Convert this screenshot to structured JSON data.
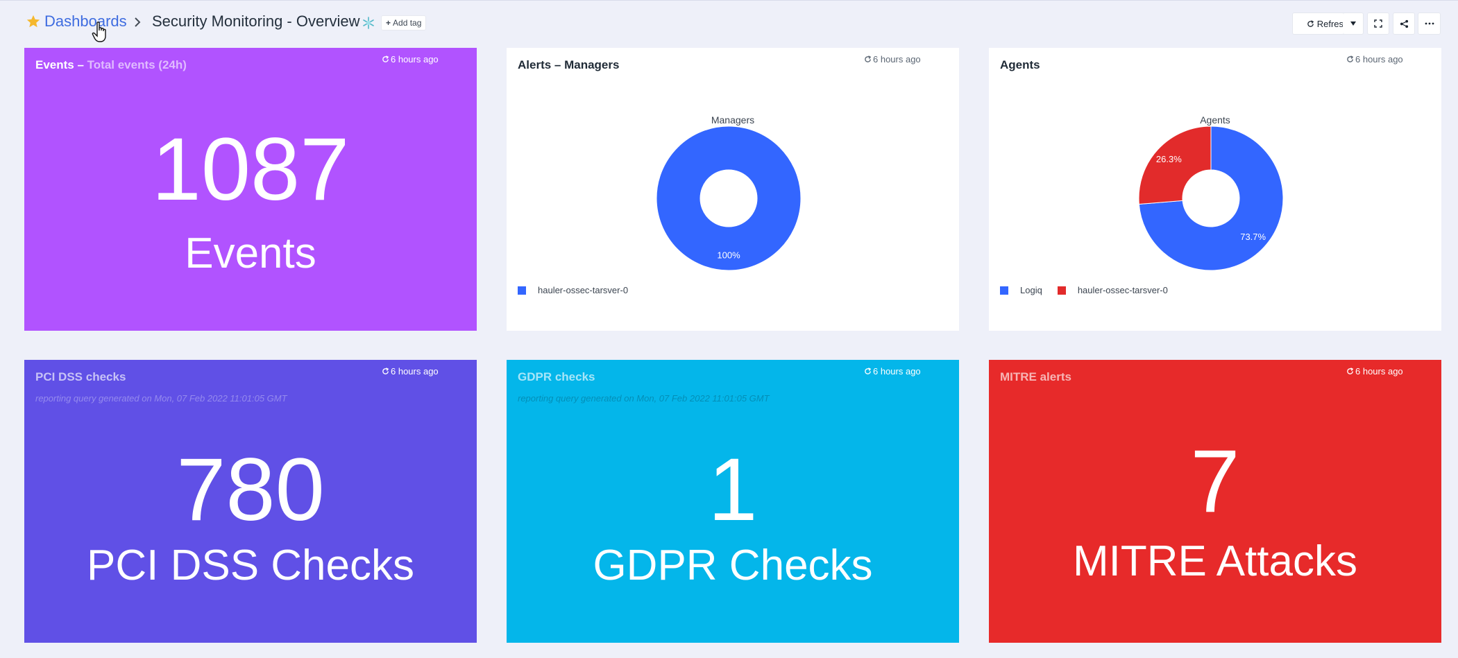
{
  "header": {
    "breadcrumb_link": "Dashboards",
    "title": "Security Monitoring - Overview",
    "add_tag": "Add tag",
    "refresh_label": "Refresh",
    "icons": [
      "star-icon",
      "chevron-right-icon",
      "tag-icon",
      "refresh-icon",
      "caret-down-icon",
      "fullscreen-icon",
      "share-icon",
      "more-icon"
    ]
  },
  "colors": {
    "accent": "#3e6ce0",
    "events": "#b153ff",
    "pci": "#6050e6",
    "gdpr": "#04b6ea",
    "mitre": "#e72a2a",
    "pie_blue": "#3366ff",
    "pie_red": "#e22b2b"
  },
  "panels": {
    "events": {
      "title": "Events",
      "subtitle": "Total events (24h)",
      "updated": "6 hours ago",
      "value": "1087",
      "label": "Events"
    },
    "alerts": {
      "title": "Alerts – Managers",
      "updated": "6 hours ago"
    },
    "agents": {
      "title": "Agents",
      "updated": "6 hours ago"
    },
    "pci": {
      "title": "PCI DSS checks",
      "updated": "6 hours ago",
      "description": "reporting query generated on Mon, 07 Feb 2022 11:01:05 GMT",
      "value": "780",
      "label": "PCI DSS Checks"
    },
    "gdpr": {
      "title": "GDPR checks",
      "updated": "6 hours ago",
      "description": "reporting query generated on Mon, 07 Feb 2022 11:01:05 GMT",
      "value": "1",
      "label": "GDPR Checks"
    },
    "mitre": {
      "title": "MITRE alerts",
      "updated": "6 hours ago",
      "value": "7",
      "label": "MITRE Attacks"
    }
  },
  "chart_data": [
    {
      "type": "pie",
      "title": "Managers",
      "categories": [
        "hauler-ossec-tarsver-0"
      ],
      "values": [
        100
      ],
      "labels": [
        "100%"
      ],
      "colors": [
        "#3366ff"
      ],
      "donut": true,
      "legend": "bottom-left"
    },
    {
      "type": "pie",
      "title": "Agents",
      "categories": [
        "Logiq",
        "hauler-ossec-tarsver-0"
      ],
      "values": [
        73.7,
        26.3
      ],
      "labels": [
        "73.7%",
        "26.3%"
      ],
      "colors": [
        "#3366ff",
        "#e22b2b"
      ],
      "donut": true,
      "legend": "bottom-left"
    }
  ]
}
